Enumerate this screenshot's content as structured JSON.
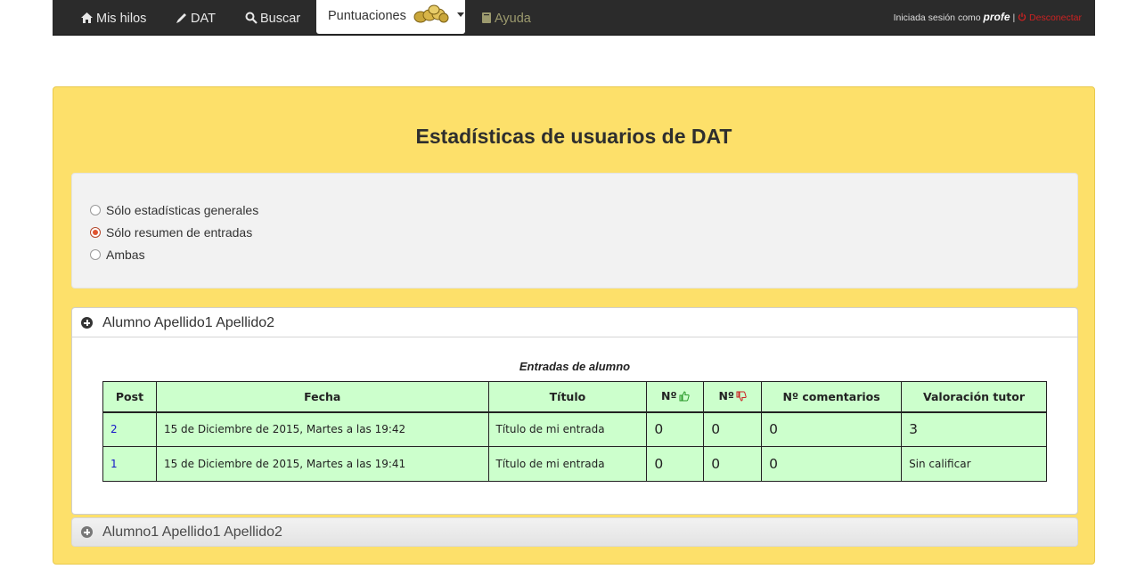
{
  "nav": {
    "home": "Mis hilos",
    "dat": "DAT",
    "buscar": "Buscar",
    "puntuaciones": "Puntuaciones",
    "ayuda": "Ayuda",
    "session_prefix": "Iniciada sesión como",
    "user": "profe",
    "separator": "|",
    "logout": "Desconectar"
  },
  "page": {
    "title": "Estadísticas de usuarios de DAT"
  },
  "options": [
    {
      "label": "Sólo estadísticas generales",
      "checked": false
    },
    {
      "label": "Sólo resumen de entradas",
      "checked": true
    },
    {
      "label": "Ambas",
      "checked": false
    }
  ],
  "students": [
    {
      "name": "Alumno Apellido1 Apellido2",
      "expanded": true,
      "caption": "Entradas de alumno",
      "columns": [
        "Post",
        "Fecha",
        "Título",
        "Nº",
        "Nº",
        "Nº comentarios",
        "Valoración tutor"
      ],
      "rows": [
        {
          "post": "2",
          "fecha": "15 de Diciembre de 2015, Martes a las 19:42",
          "titulo": "Título de mi entrada",
          "likes": "0",
          "dislikes": "0",
          "comentarios": "0",
          "valoracion": "3"
        },
        {
          "post": "1",
          "fecha": "15 de Diciembre de 2015, Martes a las 19:41",
          "titulo": "Título de mi entrada",
          "likes": "0",
          "dislikes": "0",
          "comentarios": "0",
          "valoracion": "Sin calificar"
        }
      ]
    },
    {
      "name": "Alumno1 Apellido1 Apellido2",
      "expanded": false
    }
  ],
  "colors": {
    "navbar_bg": "#2b2b2b",
    "panel_bg": "#fde06a",
    "table_bg": "#ccffcc",
    "link": "#1515c8",
    "thumb_up": "#2a9a2a",
    "thumb_down": "#cc2222",
    "logout": "#cc2222"
  }
}
